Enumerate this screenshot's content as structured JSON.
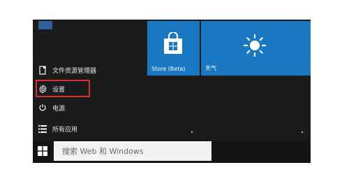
{
  "start_menu": {
    "left_items": [
      {
        "label": "文件资源管理器",
        "icon": "file-explorer-icon"
      },
      {
        "label": "设置",
        "icon": "gear-icon"
      },
      {
        "label": "电源",
        "icon": "power-icon"
      },
      {
        "label": "所有应用",
        "icon": "list-icon"
      }
    ],
    "highlight_color": "#d93030"
  },
  "tiles": {
    "store": {
      "label": "Store (Beta)",
      "icon": "shopping-bag-icon",
      "color": "#1a78c2"
    },
    "weather": {
      "label": "天气",
      "icon": "sun-icon",
      "color": "#1a78c2"
    }
  },
  "taskbar": {
    "windows_button_icon": "windows-logo-icon",
    "search_placeholder": "搜索 Web 和 Windows"
  }
}
